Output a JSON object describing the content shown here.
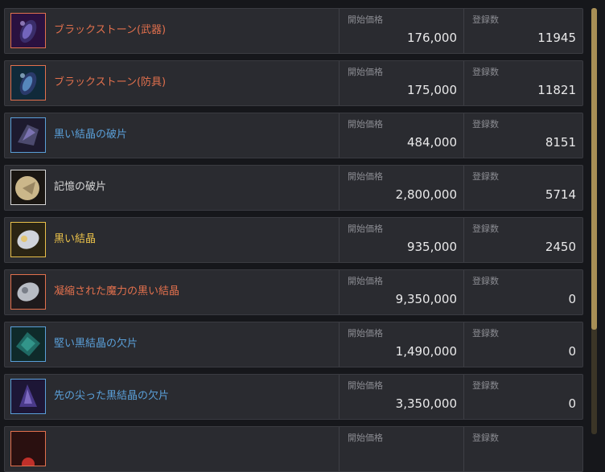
{
  "columns": {
    "price_label": "開始価格",
    "count_label": "登録数"
  },
  "colors": {
    "orange": "#e2704d",
    "blue": "#5a9fd8",
    "white": "#d6d6d6",
    "yellow": "#e9c04a"
  },
  "items": [
    {
      "name": "ブラックストーン(武器)",
      "price": "176,000",
      "count": "11945",
      "grade": "orange",
      "icon": "black-stone-weapon-icon"
    },
    {
      "name": "ブラックストーン(防具)",
      "price": "175,000",
      "count": "11821",
      "grade": "orange",
      "icon": "black-stone-armor-icon"
    },
    {
      "name": "黒い結晶の破片",
      "price": "484,000",
      "count": "8151",
      "grade": "blue",
      "icon": "black-crystal-shard-icon"
    },
    {
      "name": "記憶の破片",
      "price": "2,800,000",
      "count": "5714",
      "grade": "white",
      "icon": "memory-fragment-icon"
    },
    {
      "name": "黒い結晶",
      "price": "935,000",
      "count": "2450",
      "grade": "yellow",
      "icon": "black-crystal-icon"
    },
    {
      "name": "凝縮された魔力の黒い結晶",
      "price": "9,350,000",
      "count": "0",
      "grade": "orange",
      "icon": "concentrated-black-crystal-icon"
    },
    {
      "name": "堅い黒結晶の欠片",
      "price": "1,490,000",
      "count": "0",
      "grade": "blue",
      "icon": "hard-black-crystal-shard-icon"
    },
    {
      "name": "先の尖った黒結晶の欠片",
      "price": "3,350,000",
      "count": "0",
      "grade": "blue",
      "icon": "sharp-black-crystal-shard-icon"
    },
    {
      "name": "",
      "price": "",
      "count": "",
      "grade": "orange",
      "icon": "partial-item-icon"
    }
  ]
}
